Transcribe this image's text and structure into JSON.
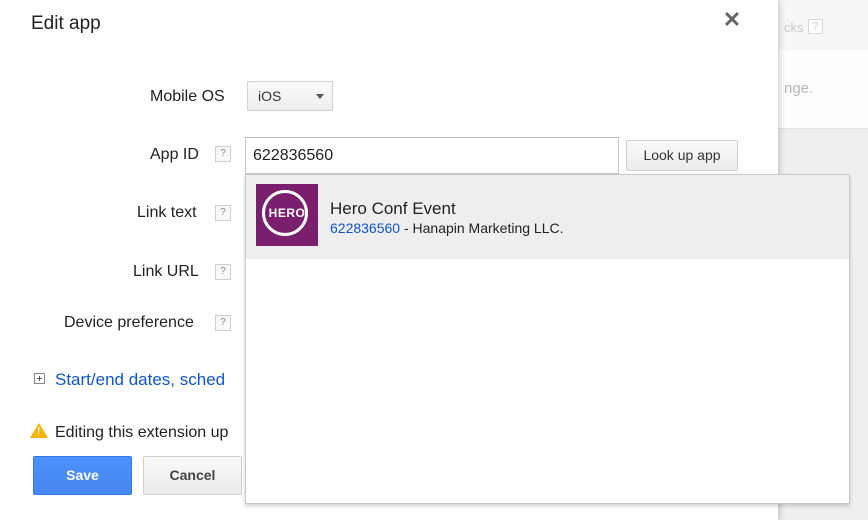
{
  "background": {
    "top_text": "cks",
    "top_help": "?",
    "mid_text": "nge."
  },
  "dialog": {
    "title": "Edit app",
    "close_glyph": "✕"
  },
  "form": {
    "mobile_os": {
      "label": "Mobile OS",
      "selected": "iOS"
    },
    "app_id": {
      "label": "App ID",
      "help": "?",
      "value": "622836560",
      "lookup_label": "Look up app"
    },
    "link_text": {
      "label": "Link text",
      "help": "?"
    },
    "link_url": {
      "label": "Link URL",
      "help": "?"
    },
    "device_preference": {
      "label": "Device preference",
      "help": "?"
    }
  },
  "suggestion": {
    "logo_text": "HERO",
    "name": "Hero Conf Event",
    "id": "622836560",
    "developer": " - Hanapin Marketing LLC."
  },
  "advanced": {
    "label": "Start/end dates, sched"
  },
  "warning": {
    "text": "Editing this extension up"
  },
  "buttons": {
    "save": "Save",
    "cancel": "Cancel"
  },
  "colors": {
    "primary": "#4d90fe",
    "link": "#1155cc",
    "warning": "#f4b400",
    "logo": "#7a1e6e"
  }
}
